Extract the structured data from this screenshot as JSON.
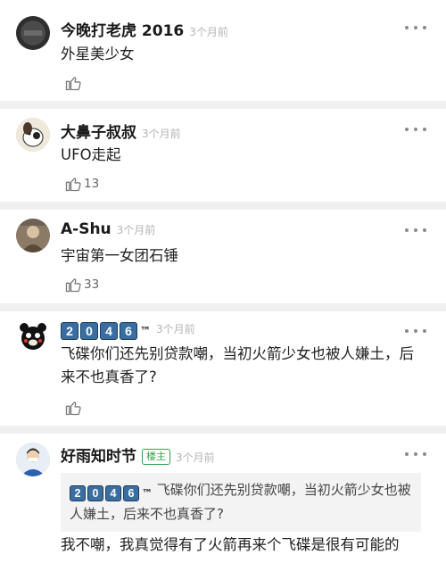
{
  "comments": [
    {
      "username": "今晚打老虎 2016",
      "time": "3个月前",
      "text": "外星美少女",
      "likes": null,
      "avatar_icon": "dark-round-avatar"
    },
    {
      "username": "大鼻子叔叔",
      "time": "3个月前",
      "text": "UFO走起",
      "likes": "13",
      "avatar_icon": "cartoon-dog-avatar"
    },
    {
      "username": "A-Shu",
      "time": "3个月前",
      "text": "宇宙第一女团石锤",
      "likes": "33",
      "avatar_icon": "photo-avatar"
    },
    {
      "username_digits": [
        "2",
        "0",
        "4",
        "6"
      ],
      "username_tm": "™",
      "time": "3个月前",
      "text": "飞碟你们还先别贷款嘲，当初火箭少女也被人嫌土，后来不也真香了?",
      "likes": null,
      "avatar_icon": "black-bear-avatar"
    },
    {
      "username": "好雨知时节",
      "host_badge": "楼主",
      "time": "3个月前",
      "quote_tm": "™",
      "quote_text": "飞碟你们还先别贷款嘲，当初火箭少女也被人嫌土，后来不也真香了?",
      "text": "我不嘲，我真觉得有了火箭再来个飞碟是很有可能的",
      "avatar_icon": "person-avatar"
    }
  ],
  "colors": {
    "accent_green": "#2fa24b",
    "digit_blue": "#3b6ea0",
    "timestamp_gray": "#b5b5b5"
  }
}
